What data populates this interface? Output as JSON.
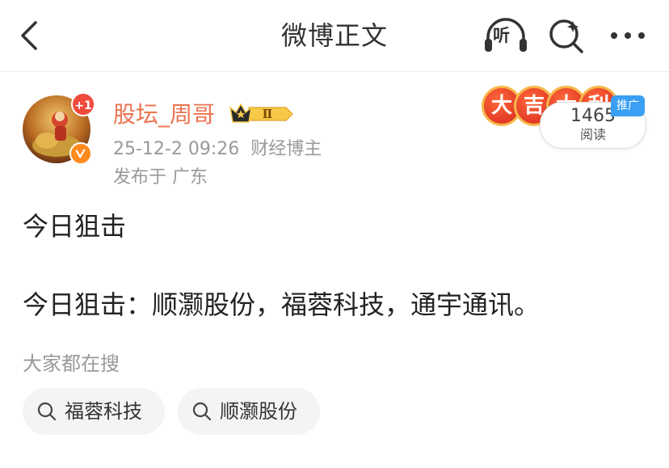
{
  "nav": {
    "title": "微博正文",
    "listen_label": "听"
  },
  "author": {
    "name": "股坛_周哥",
    "avatar_badge": "+1",
    "vip_level": "Ⅱ",
    "timestamp": "25-12-2 09:26",
    "role": "财经博主",
    "location": "发布于 广东"
  },
  "promo": {
    "chars": [
      "大",
      "吉",
      "大",
      "利"
    ],
    "read_count": "1465",
    "read_label": "阅读",
    "ad_tag": "推广"
  },
  "post": {
    "title": "今日狙击",
    "body": "今日狙击：顺灏股份，福蓉科技，通宇通讯。"
  },
  "search": {
    "header": "大家都在搜",
    "chips": [
      "福蓉科技",
      "顺灏股份"
    ]
  },
  "colors": {
    "username": "#eb7350",
    "secondary_text": "#999999",
    "chip_bg": "#f4f4f4",
    "ad_tag": "#3aa0f3"
  }
}
